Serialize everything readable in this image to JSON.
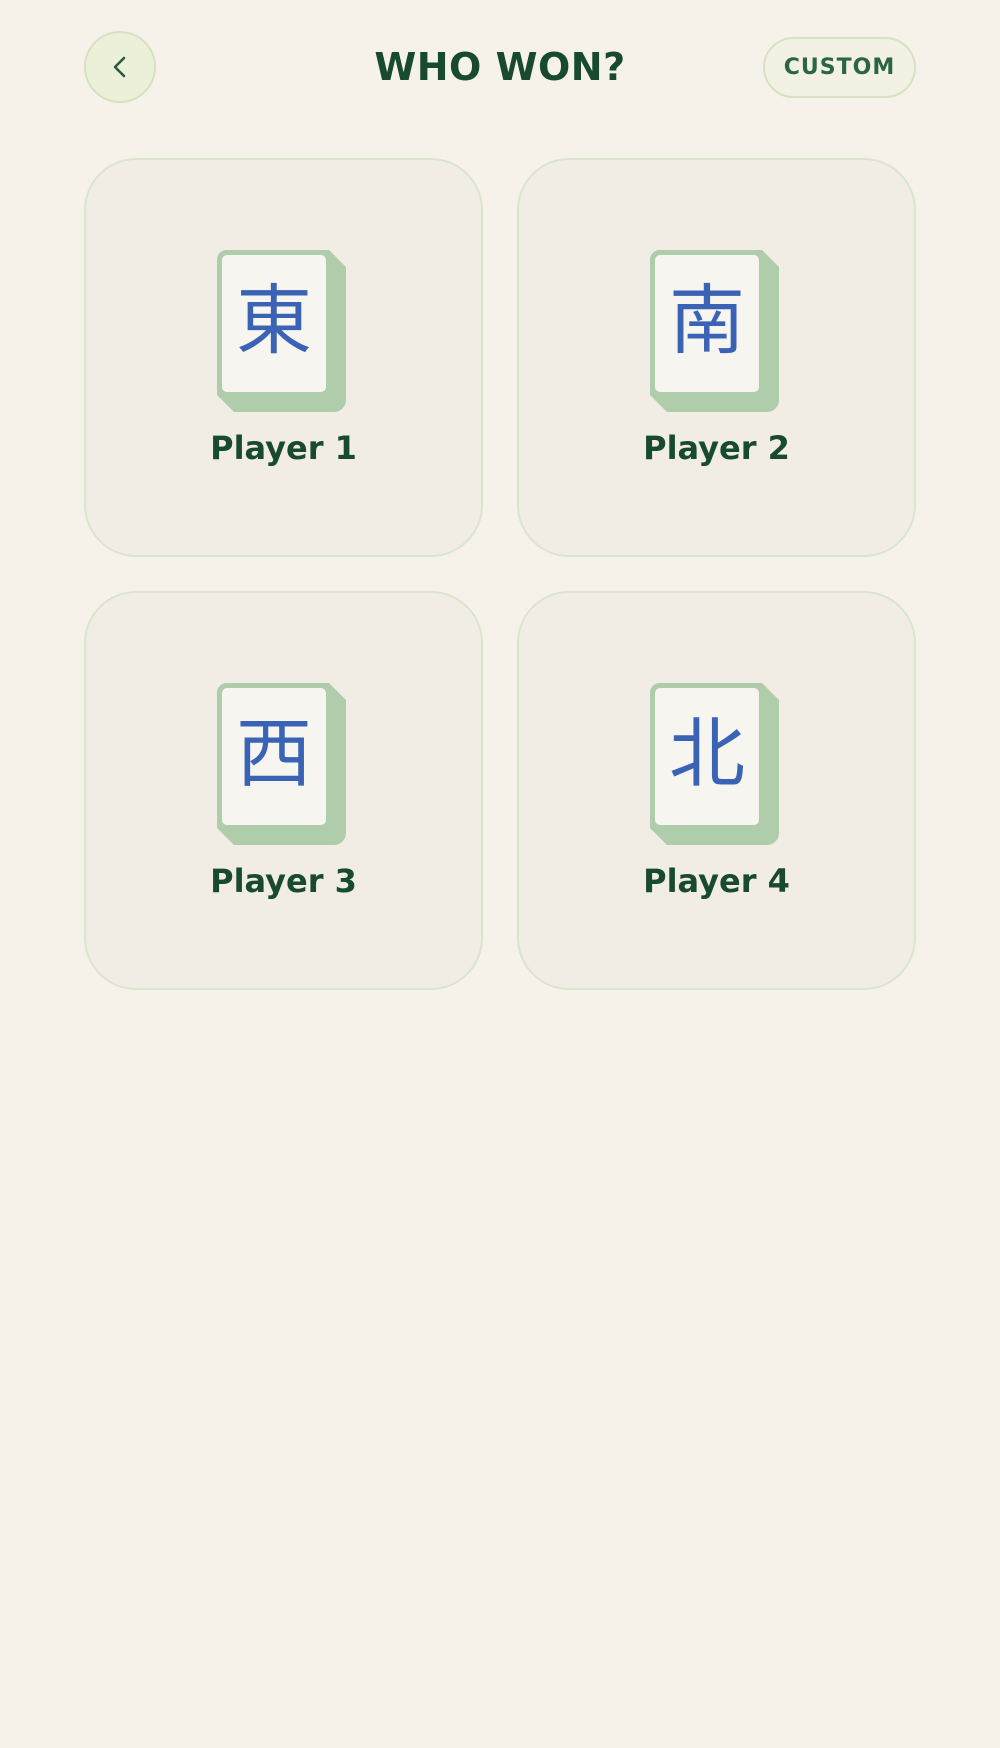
{
  "header": {
    "back_icon": "chevron-left-icon",
    "title": "WHO WON?",
    "custom_label": "CUSTOM"
  },
  "players": [
    {
      "name": "Player 1",
      "tile_char": "東",
      "tile_icon": "east-wind-tile-icon"
    },
    {
      "name": "Player 2",
      "tile_char": "南",
      "tile_icon": "south-wind-tile-icon"
    },
    {
      "name": "Player 3",
      "tile_char": "西",
      "tile_icon": "west-wind-tile-icon"
    },
    {
      "name": "Player 4",
      "tile_char": "北",
      "tile_icon": "north-wind-tile-icon"
    }
  ],
  "colors": {
    "background": "#f6f2ea",
    "card_background": "#f1ede5",
    "card_border": "#d9e5cc",
    "title_text": "#174a2e",
    "tile_green": "#afccab",
    "tile_glyph_blue": "#3b63b5",
    "back_button_fill": "#ecf0d9"
  }
}
